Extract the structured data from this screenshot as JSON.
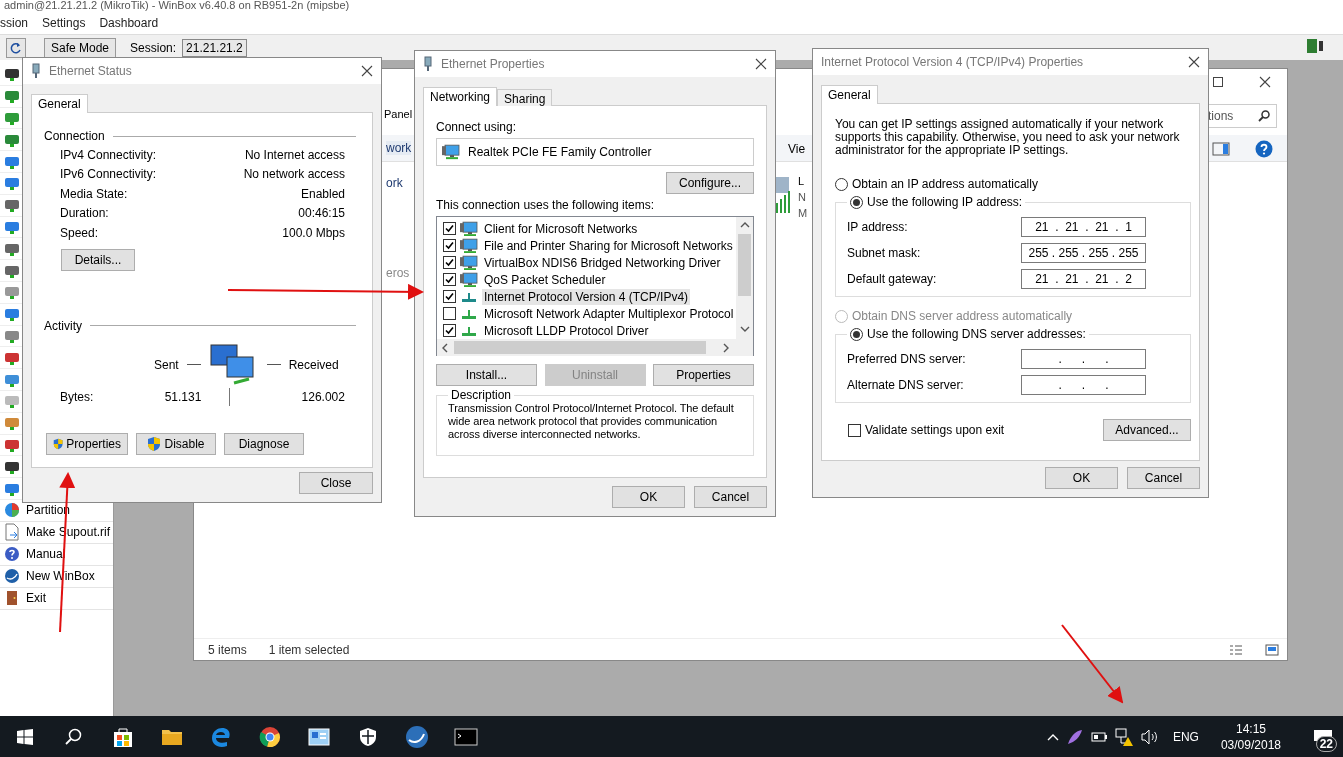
{
  "winbox": {
    "title": "admin@21.21.21.2 (MikroTik) - WinBox v6.40.8 on RB951-2n (mipsbe)",
    "menu": [
      "ssion",
      "Settings",
      "Dashboard"
    ],
    "safe_mode": "Safe Mode",
    "session_label": "Session:",
    "session_value": "21.21.21.2",
    "sidebar": [
      {
        "label": "Partition",
        "kind": "partition"
      },
      {
        "label": "Make Supout.rif",
        "kind": "file"
      },
      {
        "label": "Manual",
        "kind": "help"
      },
      {
        "label": "New WinBox",
        "kind": "globe"
      },
      {
        "label": "Exit",
        "kind": "exit"
      }
    ]
  },
  "network_window": {
    "address": "Panel",
    "search_placeholder": "tions",
    "view_label": "Vie",
    "rows": [
      {
        "text": "work",
        "selected": true
      },
      {
        "text": "ork",
        "selected": false
      },
      {
        "text": "eros",
        "selected": false
      }
    ],
    "adapter_letters": [
      "L",
      "N",
      "M"
    ],
    "status": [
      "5 items",
      "1 item selected"
    ]
  },
  "ethernet_status": {
    "title": "Ethernet Status",
    "tabs": [
      {
        "label": "General",
        "selected": true
      }
    ],
    "connection_heading": "Connection",
    "rows": [
      {
        "label": "IPv4 Connectivity:",
        "value": "No Internet access"
      },
      {
        "label": "IPv6 Connectivity:",
        "value": "No network access"
      },
      {
        "label": "Media State:",
        "value": "Enabled"
      },
      {
        "label": "Duration:",
        "value": "00:46:15"
      },
      {
        "label": "Speed:",
        "value": "100.0 Mbps"
      }
    ],
    "details_button": "Details...",
    "activity_heading": "Activity",
    "sent_label": "Sent",
    "received_label": "Received",
    "bytes_label": "Bytes:",
    "bytes_sent": "51.131",
    "bytes_received": "126.002",
    "buttons": [
      {
        "label": "Properties",
        "shield": true
      },
      {
        "label": "Disable",
        "shield": true
      },
      {
        "label": "Diagnose",
        "shield": false
      }
    ],
    "close_button": "Close"
  },
  "ethernet_properties": {
    "title": "Ethernet Properties",
    "tabs": [
      {
        "label": "Networking",
        "selected": true
      },
      {
        "label": "Sharing",
        "selected": false
      }
    ],
    "connect_using_label": "Connect using:",
    "adapter": "Realtek PCIe FE Family Controller",
    "configure_button": "Configure...",
    "items_label": "This connection uses the following items:",
    "items": [
      {
        "label": "Client for Microsoft Networks",
        "checked": true,
        "selected": false,
        "kind": "service"
      },
      {
        "label": "File and Printer Sharing for Microsoft Networks",
        "checked": true,
        "selected": false,
        "kind": "service"
      },
      {
        "label": "VirtualBox NDIS6 Bridged Networking Driver",
        "checked": true,
        "selected": false,
        "kind": "service"
      },
      {
        "label": "QoS Packet Scheduler",
        "checked": true,
        "selected": false,
        "kind": "service"
      },
      {
        "label": "Internet Protocol Version 4 (TCP/IPv4)",
        "checked": true,
        "selected": true,
        "kind": "protocol"
      },
      {
        "label": "Microsoft Network Adapter Multiplexor Protocol",
        "checked": false,
        "selected": false,
        "kind": "protocol"
      },
      {
        "label": "Microsoft LLDP Protocol Driver",
        "checked": true,
        "selected": false,
        "kind": "protocol"
      }
    ],
    "buttons": [
      {
        "label": "Install...",
        "disabled": false
      },
      {
        "label": "Uninstall",
        "disabled": true
      },
      {
        "label": "Properties",
        "disabled": false
      }
    ],
    "description_heading": "Description",
    "description": "Transmission Control Protocol/Internet Protocol. The default wide area network protocol that provides communication across diverse interconnected networks.",
    "ok_button": "OK",
    "cancel_button": "Cancel"
  },
  "ipv4_properties": {
    "title": "Internet Protocol Version 4 (TCP/IPv4) Properties",
    "tabs": [
      {
        "label": "General",
        "selected": true
      }
    ],
    "intro": "You can get IP settings assigned automatically if your network supports this capability. Otherwise, you need to ask your network administrator for the appropriate IP settings.",
    "ip_options": [
      {
        "label": "Obtain an IP address automatically",
        "selected": false,
        "disabled": false
      },
      {
        "label": "Use the following IP address:",
        "selected": true,
        "disabled": false
      }
    ],
    "ip_fields": [
      {
        "label": "IP address:",
        "value": "21  .  21  .  21  .  1"
      },
      {
        "label": "Subnet mask:",
        "value": "255 . 255 . 255 . 255"
      },
      {
        "label": "Default gateway:",
        "value": "21  .  21  .  21  .  2"
      }
    ],
    "dns_options": [
      {
        "label": "Obtain DNS server address automatically",
        "selected": false,
        "disabled": true
      },
      {
        "label": "Use the following DNS server addresses:",
        "selected": true,
        "disabled": false
      }
    ],
    "dns_fields": [
      {
        "label": "Preferred DNS server:",
        "value": ".      .      ."
      },
      {
        "label": "Alternate DNS server:",
        "value": ".      .      ."
      }
    ],
    "validate": {
      "label": "Validate settings upon exit",
      "checked": false
    },
    "advanced_button": "Advanced...",
    "ok_button": "OK",
    "cancel_button": "Cancel"
  },
  "taskbar": {
    "language": "ENG",
    "time": "14:15",
    "date": "03/09/2018",
    "notifications": "22"
  }
}
